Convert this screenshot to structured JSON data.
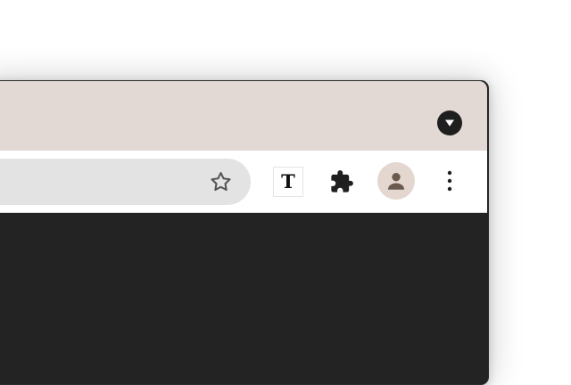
{
  "toolbar": {
    "extension_label": "T"
  },
  "icons": {
    "tab_search": "chevron-down-circle-icon",
    "bookmark": "star-outline-icon",
    "extensions": "puzzle-icon",
    "profile": "person-icon",
    "menu": "vertical-ellipsis-icon"
  },
  "colors": {
    "tab_strip": "#e2d8d4",
    "toolbar": "#ffffff",
    "omnibox": "#e3e3e3",
    "profile_bg": "#e4d7d0",
    "content": "#232323"
  }
}
